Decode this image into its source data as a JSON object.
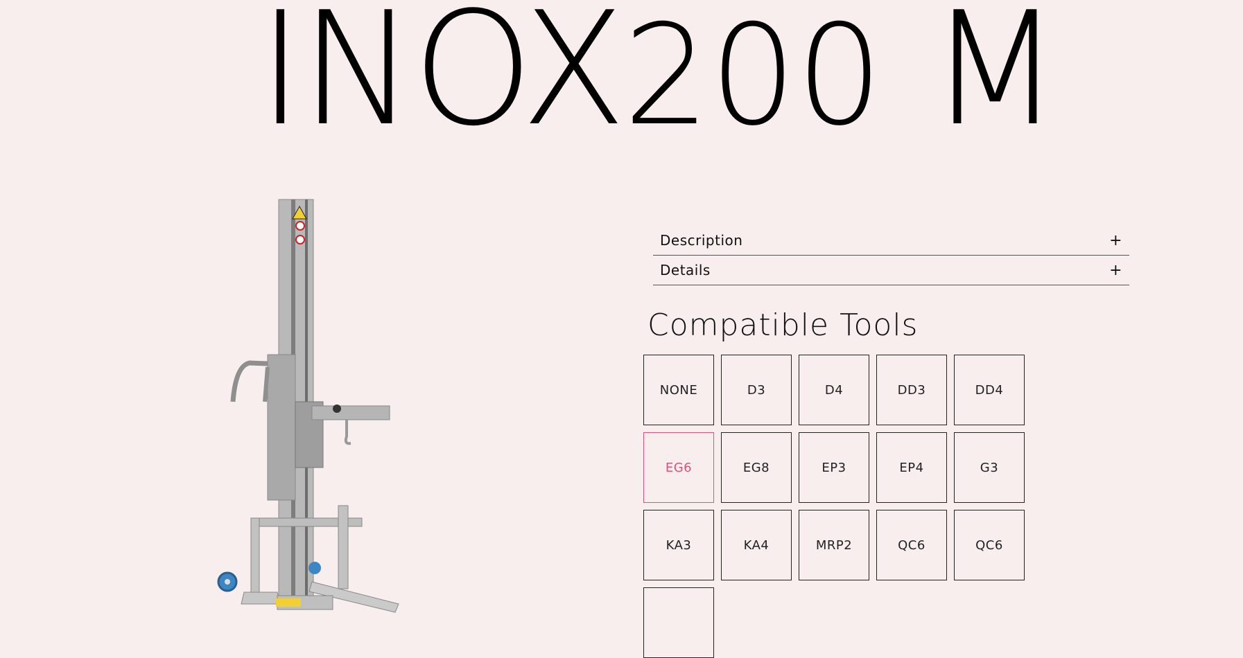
{
  "product": {
    "title_prefix": "INOX",
    "title_number": "200",
    "title_suffix": "M",
    "image_alt": "INOX200 M stainless steel lifter"
  },
  "accordion": [
    {
      "label": "Description",
      "toggle": "+"
    },
    {
      "label": "Details",
      "toggle": "+"
    }
  ],
  "compatible_tools": {
    "heading": "Compatible Tools",
    "selected": "EG6",
    "accent": "#e0507a",
    "tools": [
      "NONE",
      "D3",
      "D4",
      "DD3",
      "DD4",
      "EG6",
      "EG8",
      "EP3",
      "EP4",
      "G3",
      "KA3",
      "KA4",
      "MRP2",
      "QC6",
      "QC6",
      ""
    ]
  }
}
